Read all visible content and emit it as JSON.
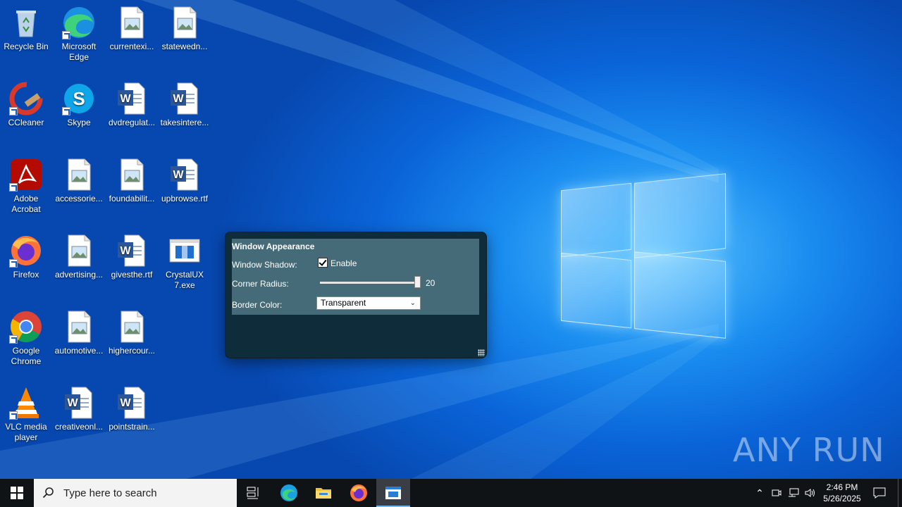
{
  "desktop_icons": [
    {
      "label": "Recycle Bin",
      "icon": "recycle-bin-icon"
    },
    {
      "label": "Microsoft Edge",
      "icon": "edge-icon"
    },
    {
      "label": "currentexi...",
      "icon": "image-file-icon"
    },
    {
      "label": "statewedn...",
      "icon": "image-file-icon"
    },
    {
      "label": "CCleaner",
      "icon": "ccleaner-icon"
    },
    {
      "label": "Skype",
      "icon": "skype-icon"
    },
    {
      "label": "dvdregulat...",
      "icon": "word-doc-icon"
    },
    {
      "label": "takesintere...",
      "icon": "word-doc-icon"
    },
    {
      "label": "Adobe Acrobat",
      "icon": "acrobat-icon"
    },
    {
      "label": "accessorie...",
      "icon": "image-file-icon"
    },
    {
      "label": "foundabilit...",
      "icon": "image-file-icon"
    },
    {
      "label": "upbrowse.rtf",
      "icon": "word-doc-icon"
    },
    {
      "label": "Firefox",
      "icon": "firefox-icon"
    },
    {
      "label": "advertising...",
      "icon": "image-file-icon"
    },
    {
      "label": "givesthe.rtf",
      "icon": "word-doc-icon"
    },
    {
      "label": "CrystalUX 7.exe",
      "icon": "crystalux-exe-icon"
    },
    {
      "label": "Google Chrome",
      "icon": "chrome-icon"
    },
    {
      "label": "automotive...",
      "icon": "image-file-icon"
    },
    {
      "label": "highercour...",
      "icon": "image-file-icon"
    },
    {
      "label": "VLC media player",
      "icon": "vlc-icon"
    },
    {
      "label": "creativeonl...",
      "icon": "word-doc-icon"
    },
    {
      "label": "pointstrain...",
      "icon": "word-doc-icon"
    }
  ],
  "dialog": {
    "title": "Window Appearance",
    "shadow_label": "Window Shadow:",
    "shadow_checkbox_label": "Enable",
    "shadow_enabled": true,
    "radius_label": "Corner Radius:",
    "radius_value": "20",
    "border_label": "Border Color:",
    "border_value": "Transparent"
  },
  "watermark": "ANY RUN",
  "taskbar": {
    "search_placeholder": "Type here to search",
    "time": "2:46 PM",
    "date": "5/26/2025"
  }
}
